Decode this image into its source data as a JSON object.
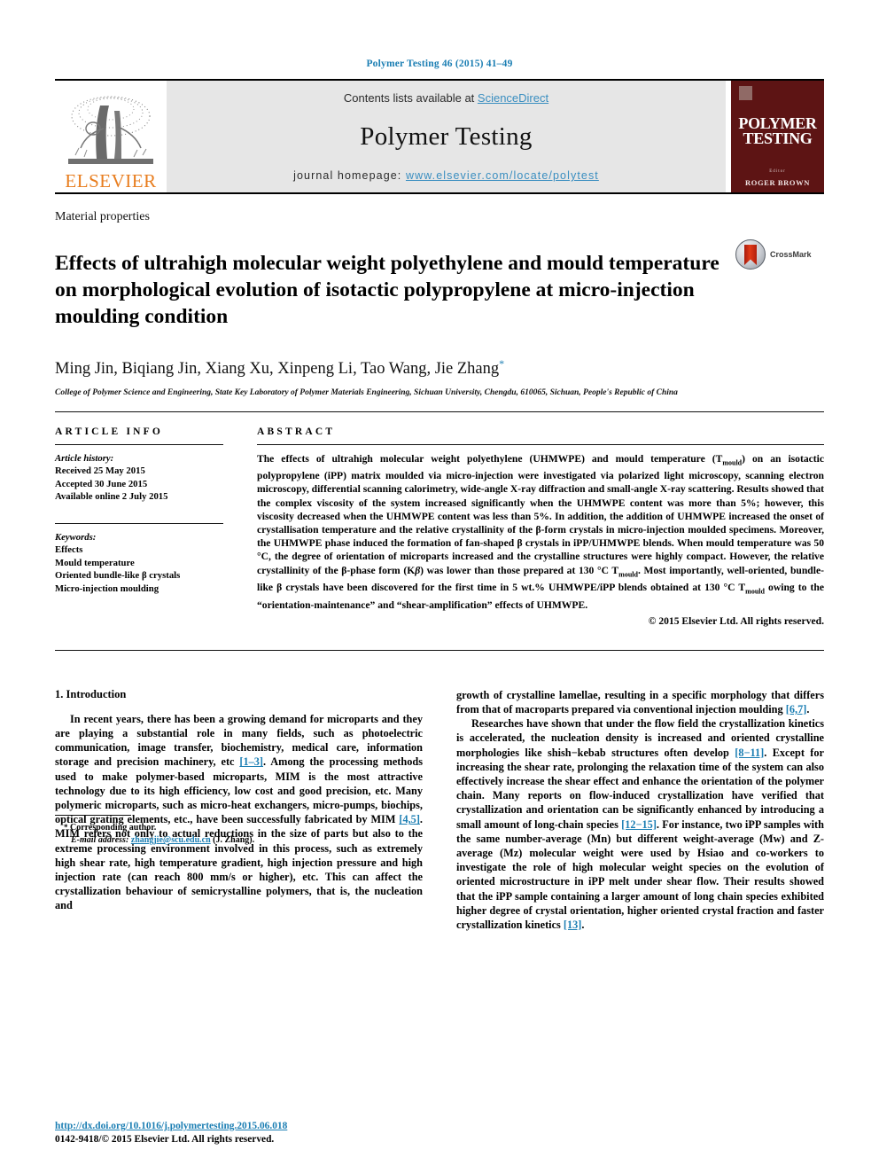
{
  "running_head": "Polymer Testing 46 (2015) 41–49",
  "masthead": {
    "elsevier_wordmark": "ELSEVIER",
    "contents_prefix": "Contents lists available at ",
    "contents_link": "ScienceDirect",
    "journal_title": "Polymer Testing",
    "homepage_prefix": "journal homepage: ",
    "homepage_link": "www.elsevier.com/locate/polytest",
    "cover_title_line1": "POLYMER",
    "cover_title_line2": "TESTING",
    "cover_editor_label": "Editor",
    "cover_editor": "ROGER BROWN"
  },
  "header": {
    "section_label": "Material properties",
    "title": "Effects of ultrahigh molecular weight polyethylene and mould temperature on morphological evolution of isotactic polypropylene at micro-injection moulding condition",
    "crossmark_label": "CrossMark",
    "authors": "Ming Jin, Biqiang Jin, Xiang Xu, Xinpeng Li, Tao Wang, Jie Zhang",
    "corresponding_marker": "*",
    "affiliation": "College of Polymer Science and Engineering, State Key Laboratory of Polymer Materials Engineering, Sichuan University, Chengdu, 610065, Sichuan, People's Republic of China"
  },
  "article_info": {
    "heading": "ARTICLE INFO",
    "history_label": "Article history:",
    "history": [
      "Received 25 May 2015",
      "Accepted 30 June 2015",
      "Available online 2 July 2015"
    ],
    "keywords_label": "Keywords:",
    "keywords": [
      "Effects",
      "Mould temperature",
      "Oriented bundle-like β crystals",
      "Micro-injection moulding"
    ]
  },
  "abstract": {
    "heading": "ABSTRACT",
    "text_part1": "The effects of ultrahigh molecular weight polyethylene (UHMWPE) and mould temperature (T",
    "text_sub1": "mould",
    "text_part2": ") on an isotactic polypropylene (iPP) matrix moulded via micro-injection were investigated via polarized light microscopy, scanning electron microscopy, differential scanning calorimetry, wide-angle X-ray diffraction and small-angle X-ray scattering. Results showed that the complex viscosity of the system increased significantly when the UHMWPE content was more than 5%; however, this viscosity decreased when the UHMWPE content was less than 5%. In addition, the addition of UHMWPE increased the onset of crystallisation temperature and the relative crystallinity of the β-form crystals in micro-injection moulded specimens. Moreover, the UHMWPE phase induced the formation of fan-shaped β crystals in iPP/UHMWPE blends. When mould temperature was 50 °C, the degree of orientation of microparts increased and the crystalline structures were highly compact. However, the relative crystallinity of the β-phase form (K",
    "text_italic1": "β",
    "text_part3": ") was lower than those prepared at 130 °C T",
    "text_sub2": "mould",
    "text_part4": ". Most importantly, well-oriented, bundle-like β crystals have been discovered for the first time in 5 wt.% UHMWPE/iPP blends obtained at 130 °C T",
    "text_sub3": "mould",
    "text_part5": " owing to the “orientation-maintenance” and “shear-amplification” effects of UHMWPE.",
    "copyright": "© 2015 Elsevier Ltd. All rights reserved."
  },
  "introduction": {
    "heading": "1. Introduction",
    "left_para1_a": "In recent years, there has been a growing demand for microparts and they are playing a substantial role in many fields, such as photoelectric communication, image transfer, biochemistry, medical care, information storage and precision machinery, etc ",
    "left_para1_ref1": "[1–3]",
    "left_para1_b": ". Among the processing methods used to make polymer-based microparts, MIM is the most attractive technology due to its high efficiency, low cost and good precision, etc. Many polymeric microparts, such as micro-heat exchangers, micro-pumps, biochips, optical grating elements, etc., have been successfully fabricated by MIM ",
    "left_para1_ref2": "[4,5]",
    "left_para1_c": ". MIM refers not only to actual reductions in the size of parts but also to the extreme processing environment involved in this process, such as extremely high shear rate, high temperature gradient, high injection pressure and high injection rate (can reach 800 mm/s or higher), etc. This can affect the crystallization behaviour of semicrystalline polymers, that is, the nucleation and",
    "right_para1_a": "growth of crystalline lamellae, resulting in a specific morphology that differs from that of macroparts prepared via conventional injection moulding ",
    "right_para1_ref": "[6,7]",
    "right_para1_b": ".",
    "right_para2_a": "Researches have shown that under the flow field the crystallization kinetics is accelerated, the nucleation density is increased and oriented crystalline morphologies like shish−kebab structures often develop ",
    "right_para2_ref1": "[8−11]",
    "right_para2_b": ". Except for increasing the shear rate, prolonging the relaxation time of the system can also effectively increase the shear effect and enhance the orientation of the polymer chain. Many reports on flow-induced crystallization have verified that crystallization and orientation can be significantly enhanced by introducing a small amount of long-chain species ",
    "right_para2_ref2": "[12−15]",
    "right_para2_c": ". For instance, two iPP samples with the same number-average (Mn) but different weight-average (Mw) and Z-average (Mz) molecular weight were used by Hsiao and co-workers to investigate the role of high molecular weight species on the evolution of oriented microstructure in iPP melt under shear flow. Their results showed that the iPP sample containing a larger amount of long chain species exhibited higher degree of crystal orientation, higher oriented crystal fraction and faster crystallization kinetics ",
    "right_para2_ref3": "[13]",
    "right_para2_d": "."
  },
  "footnote": {
    "star": "*",
    "corresponding": "Corresponding author.",
    "email_label": "E-mail address:",
    "email": "zhangjie@scu.edu.cn",
    "email_suffix": "(J. Zhang)."
  },
  "footer": {
    "doi": "http://dx.doi.org/10.1016/j.polymertesting.2015.06.018",
    "issn_copyright": "0142-9418/© 2015 Elsevier Ltd. All rights reserved."
  },
  "colors": {
    "link_blue": "#1b7eb3",
    "masthead_link_blue": "#3a8ec0",
    "elsevier_orange": "#e87d1e",
    "cover_maroon": "#5d1414",
    "masthead_gray": "#e6e6e6"
  }
}
